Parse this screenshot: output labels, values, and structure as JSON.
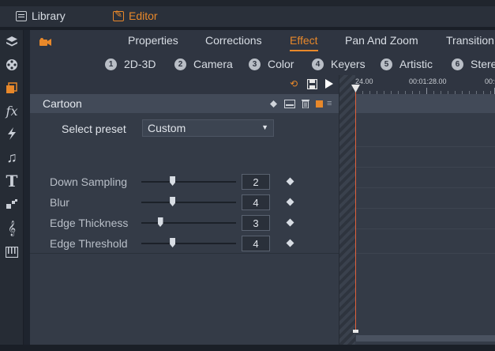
{
  "modes": [
    {
      "label": "Library",
      "icon": "library-icon"
    },
    {
      "label": "Editor",
      "icon": "editor-icon"
    }
  ],
  "sidebar": {
    "icons": [
      "media-icon",
      "film-reel-icon",
      "stack-icon",
      "fx-icon",
      "lightning-icon",
      "music-note-icon",
      "text-icon",
      "transition-icon",
      "clef-icon",
      "piano-icon"
    ]
  },
  "tabs": [
    "Properties",
    "Corrections",
    "Effect",
    "Pan And Zoom",
    "Transition"
  ],
  "active_tab": "Effect",
  "subtabs": [
    {
      "num": "1",
      "label": "2D-3D"
    },
    {
      "num": "2",
      "label": "Camera"
    },
    {
      "num": "3",
      "label": "Color"
    },
    {
      "num": "4",
      "label": "Keyers"
    },
    {
      "num": "5",
      "label": "Artistic"
    },
    {
      "num": "6",
      "label": "Stere"
    }
  ],
  "effect": {
    "title": "Cartoon",
    "preset_label": "Select preset",
    "preset_value": "Custom",
    "params": [
      {
        "label": "Down Sampling",
        "value": "2",
        "level": 0.33
      },
      {
        "label": "Blur",
        "value": "4",
        "level": 0.33
      },
      {
        "label": "Edge Thickness",
        "value": "3",
        "level": 0.2
      },
      {
        "label": "Edge Threshold",
        "value": "4",
        "level": 0.33
      }
    ]
  },
  "timeline": {
    "ticks": [
      "24.00",
      "00:01:28.00",
      "00:0"
    ]
  },
  "colors": {
    "accent": "#e8882a",
    "playhead": "#e0603a",
    "panel": "#343b47",
    "header_row": "#424a58"
  }
}
